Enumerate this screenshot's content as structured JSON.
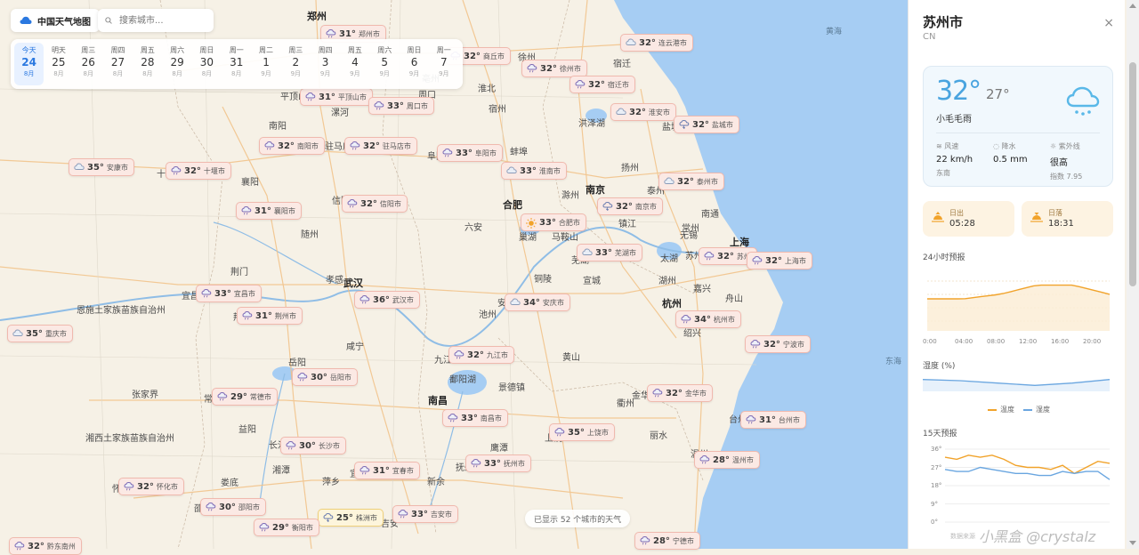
{
  "brand": {
    "title": "中国天气地图"
  },
  "search": {
    "placeholder": "搜索城市..."
  },
  "days": [
    {
      "weekday": "今天",
      "date": "24",
      "month": "8月",
      "active": true
    },
    {
      "weekday": "明天",
      "date": "25",
      "month": "8月"
    },
    {
      "weekday": "周三",
      "date": "26",
      "month": "8月"
    },
    {
      "weekday": "周四",
      "date": "27",
      "month": "8月"
    },
    {
      "weekday": "周五",
      "date": "28",
      "month": "8月"
    },
    {
      "weekday": "周六",
      "date": "29",
      "month": "8月"
    },
    {
      "weekday": "周日",
      "date": "30",
      "month": "8月"
    },
    {
      "weekday": "周一",
      "date": "31",
      "month": "8月"
    },
    {
      "weekday": "周二",
      "date": "1",
      "month": "9月"
    },
    {
      "weekday": "周三",
      "date": "2",
      "month": "9月"
    },
    {
      "weekday": "周四",
      "date": "3",
      "month": "9月"
    },
    {
      "weekday": "周五",
      "date": "4",
      "month": "9月"
    },
    {
      "weekday": "周六",
      "date": "5",
      "month": "9月"
    },
    {
      "weekday": "周日",
      "date": "6",
      "month": "9月"
    },
    {
      "weekday": "周一",
      "date": "7",
      "month": "9月"
    }
  ],
  "map_labels": [
    {
      "text": "郑州",
      "big": true
    },
    {
      "text": "南京",
      "big": true
    },
    {
      "text": "合肥",
      "big": true
    },
    {
      "text": "武汉",
      "big": true
    },
    {
      "text": "杭州",
      "big": true
    },
    {
      "text": "上海",
      "big": true
    },
    {
      "text": "南昌",
      "big": true
    },
    {
      "text": "长沙"
    },
    {
      "text": "商丘"
    },
    {
      "text": "徐州"
    },
    {
      "text": "蚌埠"
    },
    {
      "text": "扬州"
    },
    {
      "text": "南通"
    },
    {
      "text": "苏州"
    },
    {
      "text": "无锡"
    },
    {
      "text": "湖州"
    },
    {
      "text": "嘉兴"
    },
    {
      "text": "绍兴"
    },
    {
      "text": "宁波"
    },
    {
      "text": "金华"
    },
    {
      "text": "温州"
    },
    {
      "text": "台州"
    },
    {
      "text": "黄山"
    },
    {
      "text": "六安"
    },
    {
      "text": "信阳"
    },
    {
      "text": "荆门"
    },
    {
      "text": "孝感"
    },
    {
      "text": "咸宁"
    },
    {
      "text": "岳阳"
    },
    {
      "text": "九江"
    },
    {
      "text": "衢州"
    },
    {
      "text": "景德镇"
    },
    {
      "text": "株洲"
    },
    {
      "text": "衡阳"
    },
    {
      "text": "张家界"
    },
    {
      "text": "湘潭"
    },
    {
      "text": "萍乡"
    },
    {
      "text": "娄底"
    },
    {
      "text": "怀化"
    },
    {
      "text": "邵阳"
    },
    {
      "text": "益阳"
    },
    {
      "text": "常德"
    },
    {
      "text": "荆州"
    },
    {
      "text": "宜昌"
    },
    {
      "text": "恩施土家族苗族自治州"
    },
    {
      "text": "湘西土家族苗族自治州"
    },
    {
      "text": "驻马店"
    },
    {
      "text": "周口"
    },
    {
      "text": "平顶山"
    },
    {
      "text": "漯河"
    },
    {
      "text": "阜阳"
    },
    {
      "text": "淮北"
    },
    {
      "text": "亳州"
    },
    {
      "text": "宿州"
    },
    {
      "text": "滁州"
    },
    {
      "text": "芜湖"
    },
    {
      "text": "马鞍山"
    },
    {
      "text": "铜陵"
    },
    {
      "text": "安庆"
    },
    {
      "text": "池州"
    },
    {
      "text": "宣城"
    },
    {
      "text": "淮安"
    },
    {
      "text": "盐城"
    },
    {
      "text": "宿迁"
    },
    {
      "text": "泰州"
    },
    {
      "text": "常州"
    },
    {
      "text": "镇江"
    },
    {
      "text": "舟山"
    },
    {
      "text": "丽水"
    },
    {
      "text": "上饶"
    },
    {
      "text": "鹰潭"
    },
    {
      "text": "抚州"
    },
    {
      "text": "吉安"
    },
    {
      "text": "宜春"
    },
    {
      "text": "新余"
    },
    {
      "text": "随州"
    },
    {
      "text": "襄阳"
    },
    {
      "text": "十堰"
    },
    {
      "text": "南阳"
    },
    {
      "text": "鄱阳湖"
    },
    {
      "text": "巢湖"
    },
    {
      "text": "洪泽湖"
    },
    {
      "text": "太湖"
    },
    {
      "text": "黄海"
    },
    {
      "text": "东海"
    }
  ],
  "weather_chips": [
    {
      "temp": "31°",
      "city": "郑州市",
      "icon": "rain"
    },
    {
      "temp": "32°",
      "city": "商丘市",
      "icon": "rain"
    },
    {
      "temp": "32°",
      "city": "连云港市",
      "icon": "cloud"
    },
    {
      "temp": "32°",
      "city": "徐州市",
      "icon": "rain"
    },
    {
      "temp": "32°",
      "city": "宿迁市",
      "icon": "rain"
    },
    {
      "temp": "31°",
      "city": "平顶山市",
      "icon": "rain"
    },
    {
      "temp": "33°",
      "city": "周口市",
      "icon": "rain"
    },
    {
      "temp": "32°",
      "city": "淮安市",
      "icon": "cloud"
    },
    {
      "temp": "32°",
      "city": "盐城市",
      "icon": "storm"
    },
    {
      "temp": "32°",
      "city": "南阳市",
      "icon": "rain"
    },
    {
      "temp": "32°",
      "city": "驻马店市",
      "icon": "rain"
    },
    {
      "temp": "33°",
      "city": "阜阳市",
      "icon": "rain"
    },
    {
      "temp": "35°",
      "city": "安康市",
      "icon": "cloud"
    },
    {
      "temp": "32°",
      "city": "十堰市",
      "icon": "rain"
    },
    {
      "temp": "33°",
      "city": "淮南市",
      "icon": "cloud"
    },
    {
      "temp": "32°",
      "city": "泰州市",
      "icon": "cloud"
    },
    {
      "temp": "32°",
      "city": "信阳市",
      "icon": "rain"
    },
    {
      "temp": "31°",
      "city": "襄阳市",
      "icon": "rain"
    },
    {
      "temp": "33°",
      "city": "合肥市",
      "icon": "sun"
    },
    {
      "temp": "32°",
      "city": "南京市",
      "icon": "storm"
    },
    {
      "temp": "33°",
      "city": "芜湖市",
      "icon": "cloud"
    },
    {
      "temp": "32°",
      "city": "苏州",
      "icon": "rain"
    },
    {
      "temp": "32°",
      "city": "上海市",
      "icon": "rain"
    },
    {
      "temp": "33°",
      "city": "宜昌市",
      "icon": "rain"
    },
    {
      "temp": "36°",
      "city": "武汉市",
      "icon": "rain"
    },
    {
      "temp": "34°",
      "city": "安庆市",
      "icon": "cloud"
    },
    {
      "temp": "31°",
      "city": "荆州市",
      "icon": "rain"
    },
    {
      "temp": "35°",
      "city": "重庆市",
      "icon": "cloud"
    },
    {
      "temp": "34°",
      "city": "杭州市",
      "icon": "rain"
    },
    {
      "temp": "32°",
      "city": "宁波市",
      "icon": "rain"
    },
    {
      "temp": "32°",
      "city": "九江市",
      "icon": "rain"
    },
    {
      "temp": "30°",
      "city": "岳阳市",
      "icon": "rain"
    },
    {
      "temp": "29°",
      "city": "常德市",
      "icon": "rain"
    },
    {
      "temp": "32°",
      "city": "金华市",
      "icon": "rain"
    },
    {
      "temp": "33°",
      "city": "南昌市",
      "icon": "rain"
    },
    {
      "temp": "35°",
      "city": "上饶市",
      "icon": "rain"
    },
    {
      "temp": "31°",
      "city": "台州市",
      "icon": "rain"
    },
    {
      "temp": "30°",
      "city": "长沙市",
      "icon": "rain"
    },
    {
      "temp": "33°",
      "city": "抚州市",
      "icon": "rain"
    },
    {
      "temp": "31°",
      "city": "宜春市",
      "icon": "rain"
    },
    {
      "temp": "28°",
      "city": "温州市",
      "icon": "rain"
    },
    {
      "temp": "32°",
      "city": "怀化市",
      "icon": "rain"
    },
    {
      "temp": "30°",
      "city": "邵阳市",
      "icon": "rain"
    },
    {
      "temp": "25°",
      "city": "株洲市",
      "icon": "storm",
      "sun": true
    },
    {
      "temp": "33°",
      "city": "吉安市",
      "icon": "rain"
    },
    {
      "temp": "29°",
      "city": "衡阳市",
      "icon": "rain"
    },
    {
      "temp": "32°",
      "city": "黔东南州",
      "icon": "rain"
    },
    {
      "temp": "28°",
      "city": "宁德市",
      "icon": "rain"
    }
  ],
  "map_status": "已显示 52 个城市的天气",
  "panel": {
    "city": "苏州市",
    "country": "CN",
    "close": "×",
    "current": {
      "temp": "32°",
      "feels": "27°",
      "desc": "小毛毛雨"
    },
    "stats": [
      {
        "label": "风速",
        "value": "22 km/h",
        "sub": "东南",
        "icon": "wind"
      },
      {
        "label": "降水",
        "value": "0.5 mm",
        "sub": "",
        "icon": "drop"
      },
      {
        "label": "紫外线",
        "value": "很高",
        "sub": "指数 7.95",
        "icon": "sun"
      }
    ],
    "sunrise": {
      "label": "日出",
      "value": "05:28"
    },
    "sunset": {
      "label": "日落",
      "value": "18:31"
    },
    "hourly_title": "24小时预报",
    "hourly_ticks": [
      "0:00",
      "04:00",
      "08:00",
      "12:00",
      "16:00",
      "20:00"
    ],
    "humidity_title": "湿度 (%)",
    "legend": [
      "温度",
      "湿度"
    ],
    "forecast_title": "15天预报",
    "forecast_yticks": [
      "36°",
      "27°",
      "18°",
      "9°",
      "0°"
    ],
    "source": "数据来源",
    "watermark": "小黑盒 @crystalz"
  },
  "colors": {
    "accent": "#2a78e0",
    "temp_line": "#f1a32b",
    "humidity_line": "#6aa6e0",
    "sea": "#a6cdf3"
  },
  "chart_data": [
    {
      "type": "area",
      "name_hint": "24小时预报",
      "x": [
        "0:00",
        "04:00",
        "08:00",
        "12:00",
        "16:00",
        "20:00"
      ],
      "series": [
        {
          "name": "温度",
          "values": [
            27,
            27,
            28,
            30,
            30,
            28
          ]
        }
      ]
    },
    {
      "type": "line",
      "name_hint": "湿度 (%)",
      "series": [
        {
          "name": "湿度",
          "values": [
            80,
            79,
            77,
            75,
            77,
            80
          ]
        }
      ]
    },
    {
      "type": "line",
      "name_hint": "15天预报",
      "yticks": [
        "36°",
        "27°",
        "18°",
        "9°",
        "0°"
      ],
      "ylim": [
        0,
        36
      ],
      "series": [
        {
          "name": "high",
          "values": [
            32,
            31,
            33,
            32,
            33,
            31,
            28,
            27,
            27,
            26,
            28,
            24,
            27,
            30,
            29
          ]
        },
        {
          "name": "low",
          "values": [
            26,
            25,
            25,
            27,
            26,
            25,
            24,
            24,
            23,
            23,
            25,
            24,
            25,
            25,
            21
          ]
        }
      ]
    }
  ]
}
